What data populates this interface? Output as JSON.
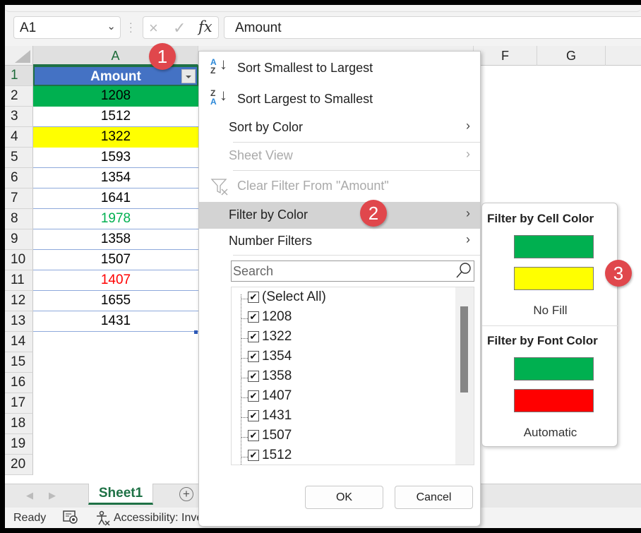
{
  "formula_bar": {
    "name_box": "A1",
    "formula": "Amount",
    "cancel_icon": "×",
    "enter_icon": "✓",
    "fx_label": "fx"
  },
  "columns": [
    "A",
    "F",
    "G"
  ],
  "rows": [
    "1",
    "2",
    "3",
    "4",
    "5",
    "6",
    "7",
    "8",
    "9",
    "10",
    "11",
    "12",
    "13",
    "14",
    "15",
    "16",
    "17",
    "18",
    "19",
    "20"
  ],
  "header_cell": "Amount",
  "cells": [
    {
      "value": "1208",
      "fill": "#00b050",
      "font": "#000000"
    },
    {
      "value": "1512",
      "fill": "#ffffff",
      "font": "#000000"
    },
    {
      "value": "1322",
      "fill": "#ffff00",
      "font": "#000000"
    },
    {
      "value": "1593",
      "fill": "#ffffff",
      "font": "#000000"
    },
    {
      "value": "1354",
      "fill": "#ffffff",
      "font": "#000000"
    },
    {
      "value": "1641",
      "fill": "#ffffff",
      "font": "#000000"
    },
    {
      "value": "1978",
      "fill": "#ffffff",
      "font": "#00b050"
    },
    {
      "value": "1358",
      "fill": "#ffffff",
      "font": "#000000"
    },
    {
      "value": "1507",
      "fill": "#ffffff",
      "font": "#000000"
    },
    {
      "value": "1407",
      "fill": "#ffffff",
      "font": "#ff0000"
    },
    {
      "value": "1655",
      "fill": "#ffffff",
      "font": "#000000"
    },
    {
      "value": "1431",
      "fill": "#ffffff",
      "font": "#000000"
    }
  ],
  "sheet_tabs": {
    "active": "Sheet1",
    "add_label": "+"
  },
  "status_bar": {
    "ready": "Ready",
    "accessibility": "Accessibility: Inve"
  },
  "filter_menu": {
    "sort_asc": "Sort Smallest to Largest",
    "sort_desc": "Sort Largest to Smallest",
    "sort_by_color": "Sort by Color",
    "sheet_view": "Sheet View",
    "clear_filter": "Clear Filter From \"Amount\"",
    "filter_by_color": "Filter by Color",
    "number_filters": "Number Filters",
    "search_placeholder": "Search",
    "list": [
      "(Select All)",
      "1208",
      "1322",
      "1354",
      "1358",
      "1407",
      "1431",
      "1507",
      "1512"
    ],
    "ok": "OK",
    "cancel": "Cancel"
  },
  "color_submenu": {
    "cell_color_title": "Filter by Cell Color",
    "cell_colors": [
      "#00b050",
      "#ffff00"
    ],
    "no_fill": "No Fill",
    "font_color_title": "Filter by Font Color",
    "font_colors": [
      "#00b050",
      "#ff0000"
    ],
    "automatic": "Automatic"
  },
  "badges": [
    "1",
    "2",
    "3"
  ],
  "colors": {
    "accent_green": "#1e7145",
    "header_blue": "#4472c4",
    "badge_red": "#e0474c"
  }
}
